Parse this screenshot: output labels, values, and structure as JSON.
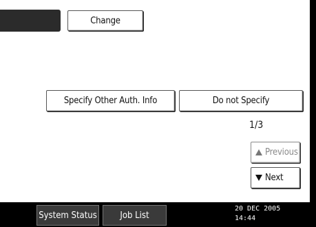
{
  "top": {
    "change_label": "Change"
  },
  "auth": {
    "specify_other_label": "Specify Other Auth. Info",
    "do_not_specify_label": "Do not Specify"
  },
  "pager": {
    "counter": "1/3",
    "previous_label": "Previous",
    "next_label": "Next"
  },
  "footer": {
    "system_status_label": "System Status",
    "job_list_label": "Job List",
    "date": "20 DEC  2005",
    "time": "14:44"
  }
}
